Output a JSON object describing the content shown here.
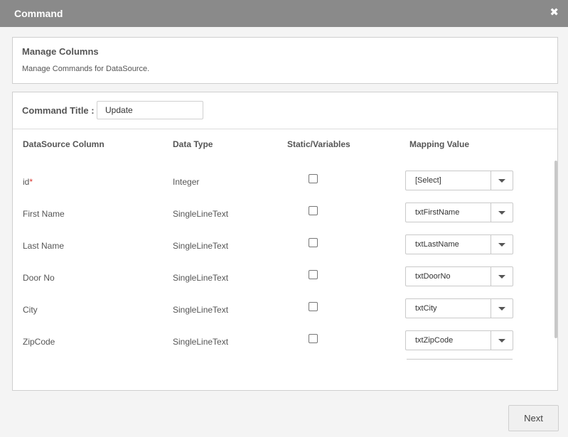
{
  "dialog": {
    "title": "Command",
    "close_glyph": "✖",
    "close_icon": "close-icon"
  },
  "manage": {
    "title": "Manage Columns",
    "subtitle": "Manage Commands for DataSource."
  },
  "command_title": {
    "label": "Command Title :",
    "value": "Update"
  },
  "columns": [
    "DataSource Column",
    "Data Type",
    "Static/Variables",
    "Mapping Value"
  ],
  "rows": [
    {
      "name": "id",
      "required_mark": "*",
      "type": "Integer",
      "static": false,
      "mapping": "[Select]"
    },
    {
      "name": "First Name",
      "type": "SingleLineText",
      "static": false,
      "mapping": "txtFirstName"
    },
    {
      "name": "Last Name",
      "type": "SingleLineText",
      "static": false,
      "mapping": "txtLastName"
    },
    {
      "name": "Door No",
      "type": "SingleLineText",
      "static": false,
      "mapping": "txtDoorNo"
    },
    {
      "name": "City",
      "type": "SingleLineText",
      "static": false,
      "mapping": "txtCity"
    },
    {
      "name": "ZipCode",
      "type": "SingleLineText",
      "static": false,
      "mapping": "txtZipCode"
    }
  ],
  "footer": {
    "next_label": "Next"
  }
}
